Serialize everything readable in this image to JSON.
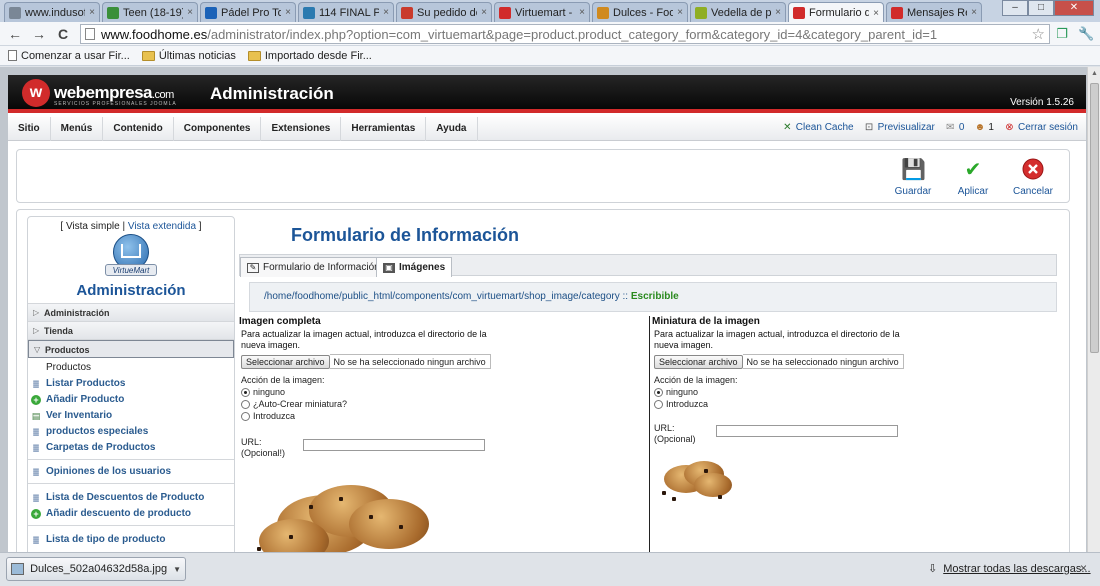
{
  "browser": {
    "tabs": [
      {
        "title": "www.indusof",
        "icon_color": "#7a8796",
        "active": false
      },
      {
        "title": "Teen (18-19)",
        "icon_color": "#3a8f3a",
        "active": false
      },
      {
        "title": "Pádel Pro To",
        "icon_color": "#1b62b8",
        "active": false
      },
      {
        "title": "114 FINAL PF",
        "icon_color": "#2a7ab0",
        "active": false
      },
      {
        "title": "Su pedido de",
        "icon_color": "#c93a2c",
        "active": false
      },
      {
        "title": "Virtuemart -",
        "icon_color": "#d12b2b",
        "active": false
      },
      {
        "title": "Dulces - Foo",
        "icon_color": "#d08a1f",
        "active": false
      },
      {
        "title": "Vedella de pa",
        "icon_color": "#8fae24",
        "active": false
      },
      {
        "title": "Formulario d",
        "icon_color": "#d12b2b",
        "active": true
      },
      {
        "title": "Mensajes Re",
        "icon_color": "#d12b2b",
        "active": false
      }
    ],
    "tab_close_glyph": "×",
    "window_controls": {
      "minimize": "–",
      "maximize": "□",
      "close": "✕"
    },
    "nav": {
      "back": "←",
      "forward": "→",
      "reload": "C"
    },
    "url_host": "www.foodhome.es",
    "url_path": "/administrator/index.php?option=com_virtuemart&page=product.product_category_form&category_id=4&category_parent_id=1",
    "bookmarks": [
      {
        "label": "Comenzar a usar Fir...",
        "type": "page"
      },
      {
        "label": "Últimas noticias",
        "type": "folder"
      },
      {
        "label": "Importado desde Fir...",
        "type": "folder"
      }
    ]
  },
  "admin": {
    "brand": {
      "name": "webempresa",
      "suffix": ".com",
      "tagline": "SERVICIOS PROFESIONALES JOOMLA",
      "mark": "w"
    },
    "title": "Administración",
    "version": "Versión 1.5.26",
    "menu": [
      "Sitio",
      "Menús",
      "Contenido",
      "Componentes",
      "Extensiones",
      "Herramientas",
      "Ayuda"
    ],
    "status": {
      "clean_cache": "Clean Cache",
      "preview": "Previsualizar",
      "messages_count": "0",
      "users_count": "1",
      "logout": "Cerrar sesión"
    },
    "toolbar": {
      "save": "Guardar",
      "apply": "Aplicar",
      "cancel": "Cancelar"
    }
  },
  "vm": {
    "view_prefix": "[ Vista simple | ",
    "view_extended": "Vista extendida",
    "view_suffix": " ]",
    "logo_text": "VirtueMart",
    "title": "Administración",
    "sections": {
      "admin": "Administración",
      "store": "Tienda",
      "products": "Productos"
    },
    "products_items": [
      {
        "label": "Productos",
        "plain": true,
        "icon": ""
      },
      {
        "label": "Listar Productos",
        "plain": false,
        "icon": "≣"
      },
      {
        "label": "Añadir Producto",
        "plain": false,
        "icon": "+"
      },
      {
        "label": "Ver Inventario",
        "plain": false,
        "icon": "▤"
      },
      {
        "label": "productos especiales",
        "plain": false,
        "icon": "≣"
      },
      {
        "label": "Carpetas de Productos",
        "plain": false,
        "icon": "≣"
      }
    ],
    "reviews": "Opiniones de los usuarios",
    "discounts_list": "Lista de Descuentos de Producto",
    "discounts_add": "Añadir descuento de producto",
    "types_list": "Lista de tipo de producto"
  },
  "form": {
    "title": "Formulario de Información",
    "tab_info": "Formulario de Información",
    "tab_images": "Imágenes",
    "path": "/home/foodhome/public_html/components/com_virtuemart/shop_image/category",
    "path_sep": " :: ",
    "path_status": "Escribible",
    "full": {
      "heading": "Imagen completa",
      "instructions": "Para actualizar la imagen actual, introduzca el directorio de la nueva imagen.",
      "file_button": "Seleccionar archivo",
      "file_status": "No se ha seleccionado ningun archivo",
      "action_label": "Acción de la imagen:",
      "options": [
        "ninguno",
        "¿Auto-Crear miniatura?",
        "Introduzca"
      ],
      "url_label": "URL:",
      "url_optional": "(Opcional!)"
    },
    "thumb": {
      "heading": "Miniatura de la imagen",
      "instructions": "Para actualizar la imagen actual, introduzca el directorio de la nueva imagen.",
      "file_button": "Seleccionar archivo",
      "file_status": "No se ha seleccionado ningun archivo",
      "action_label": "Acción de la imagen:",
      "options": [
        "ninguno",
        "Introduzca"
      ],
      "url_label": "URL:",
      "url_optional": "(Opcional)"
    }
  },
  "downloads": {
    "file": "Dulces_502a04632d58a.jpg",
    "show_all": "Mostrar todas las descargas...",
    "close": "×"
  }
}
